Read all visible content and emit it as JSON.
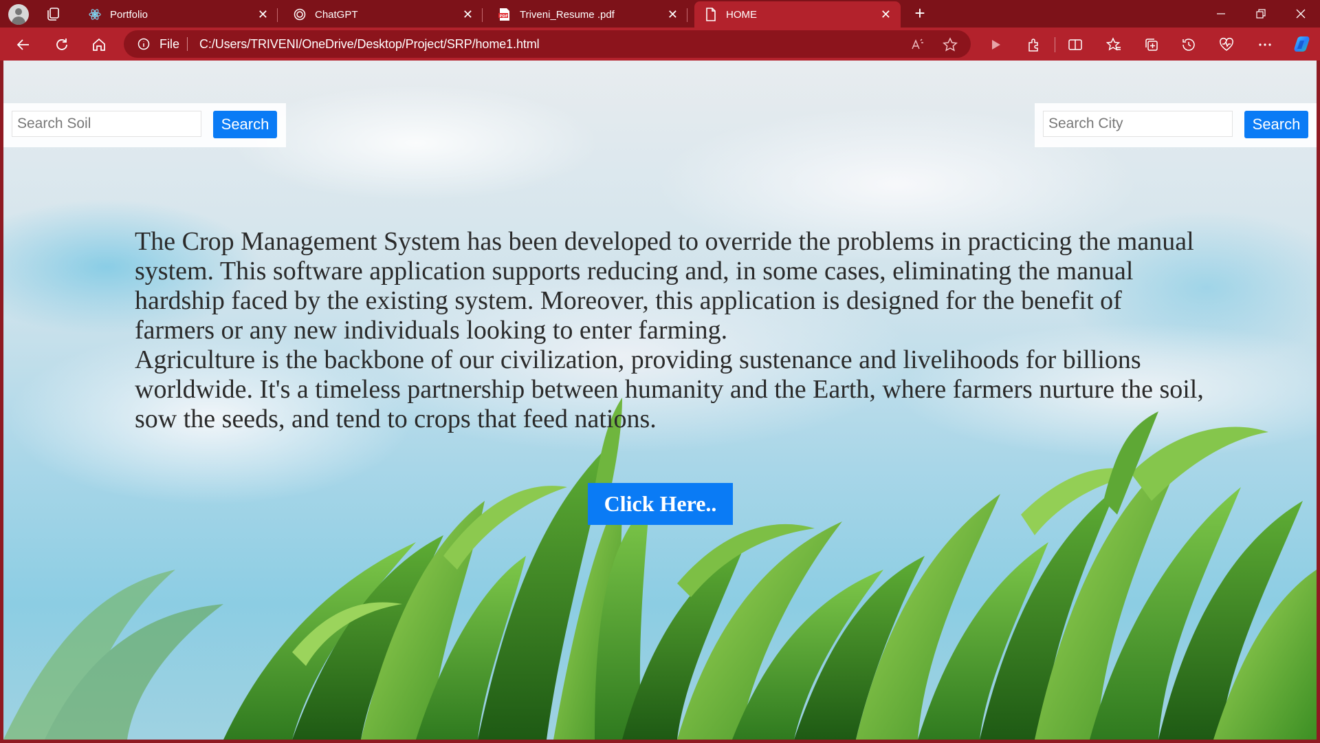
{
  "browser": {
    "tabs": [
      {
        "title": "Portfolio",
        "icon": "react-icon",
        "active": false
      },
      {
        "title": "ChatGPT",
        "icon": "chatgpt-icon",
        "active": false
      },
      {
        "title": "Triveni_Resume .pdf",
        "icon": "pdf-icon",
        "active": false
      },
      {
        "title": "HOME",
        "icon": "page-icon",
        "active": true
      }
    ],
    "address": {
      "scheme_label": "File",
      "url": "C:/Users/TRIVENI/OneDrive/Desktop/Project/SRP/home1.html"
    },
    "colors": {
      "frame": "#b3222c",
      "tabstrip": "#7d1219",
      "omnibox": "#8c141c"
    }
  },
  "page": {
    "soil_search": {
      "placeholder": "Search Soil",
      "button_label": "Search"
    },
    "city_search": {
      "placeholder": "Search City",
      "button_label": "Search"
    },
    "description": [
      "The Crop Management System has been developed to override the problems in practicing the manual system. This software application supports reducing and, in some cases, eliminating the manual hardship faced by the existing system. Moreover, this application is designed for the benefit of farmers or any new individuals looking to enter farming.",
      "Agriculture is the backbone of our civilization, providing sustenance and livelihoods for billions worldwide. It's a timeless partnership between humanity and the Earth, where farmers nurture the soil, sow the seeds, and tend to crops that feed nations."
    ],
    "cta_label": "Click Here..",
    "accent_color": "#0a7bf5"
  }
}
